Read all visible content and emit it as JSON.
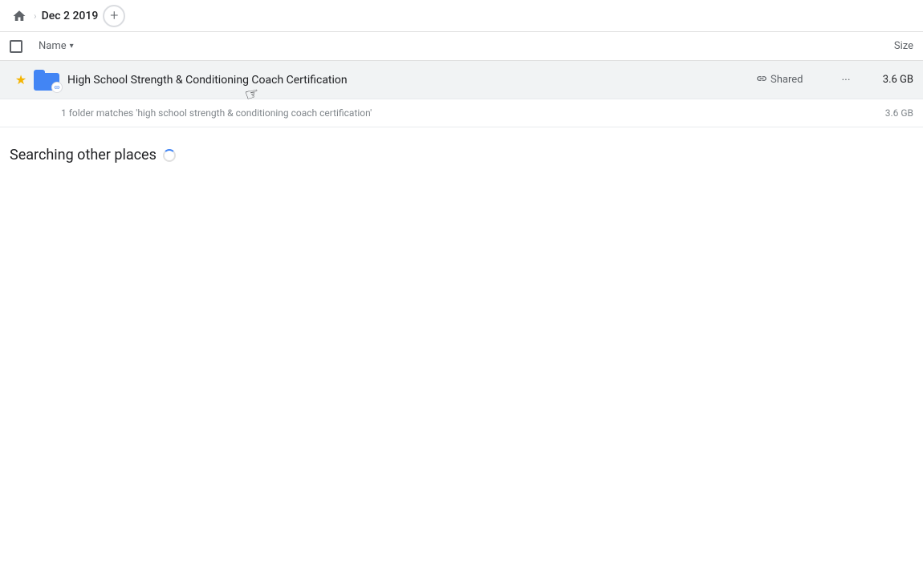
{
  "topbar": {
    "home_icon": "🏠",
    "chevron": "›",
    "date": "Dec 2 2019",
    "add_button": "+"
  },
  "columns": {
    "name_label": "Name",
    "sort_arrow": "▾",
    "size_label": "Size"
  },
  "file_row": {
    "name": "High School Strength & Conditioning Coach Certification",
    "shared_label": "Shared",
    "more_label": "···",
    "size": "3.6 GB",
    "star": "★"
  },
  "match_info": {
    "text": "1 folder matches 'high school strength & conditioning coach certification'",
    "size": "3.6 GB"
  },
  "searching": {
    "title": "Searching other places"
  }
}
